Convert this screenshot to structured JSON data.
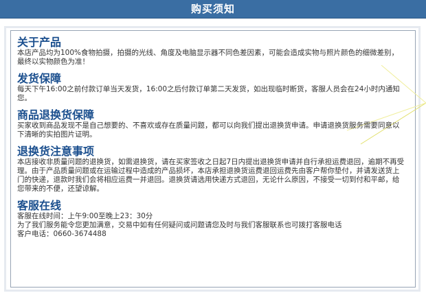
{
  "header": {
    "title": "购买须知"
  },
  "sections": [
    {
      "title": "关于产品",
      "body": "本店产品均为100%食物拍摄，拍摄的光线、角度及电脑显示器不同色差因素，可能会造成实物与照片颜色的细微差别，最终以实物颜色为准！"
    },
    {
      "title": "发货保障",
      "body": "每天下午16:00之前付款订单当天发货，16:00之后付款订单第二天发货，如出现临时断货，客服人员会在24小时内通知您。"
    },
    {
      "title": "商品退换货保障",
      "body": "买家收到商品发现不是自己想要的、不喜欢或存在质量问题，都可以向我们提出退换货申请。申请退换货服务需要同意以下清晰的实拍图片证明。"
    },
    {
      "title": "退换货注意事项",
      "body": "本店接收非质量问题的退换货，如需退换货，请在买家签收之日起7日内提出退换货申请并自行承担运费退回，逾期不再受理。由于产品质量问题或在运输过程中造成的产品损坏，本店承担退换货运费退回运费先由客户帮你垫付，并请发送货上门的快递，退款时我们会将相应运费一并退回。退换货请选用快递方式退回，无论什么原因，不接受一切到付和平邮，给您带来的不便，还望谅解。"
    },
    {
      "title": "客服在线",
      "lines": [
        "客服在线时间：上午9:00至晚上23：30分",
        "为了我们服务能令您更加满意，交易中如有任何疑问或问题请您及时与我们客服联系也可拨打客服电话",
        "客户电话：0660-3674488"
      ]
    }
  ]
}
